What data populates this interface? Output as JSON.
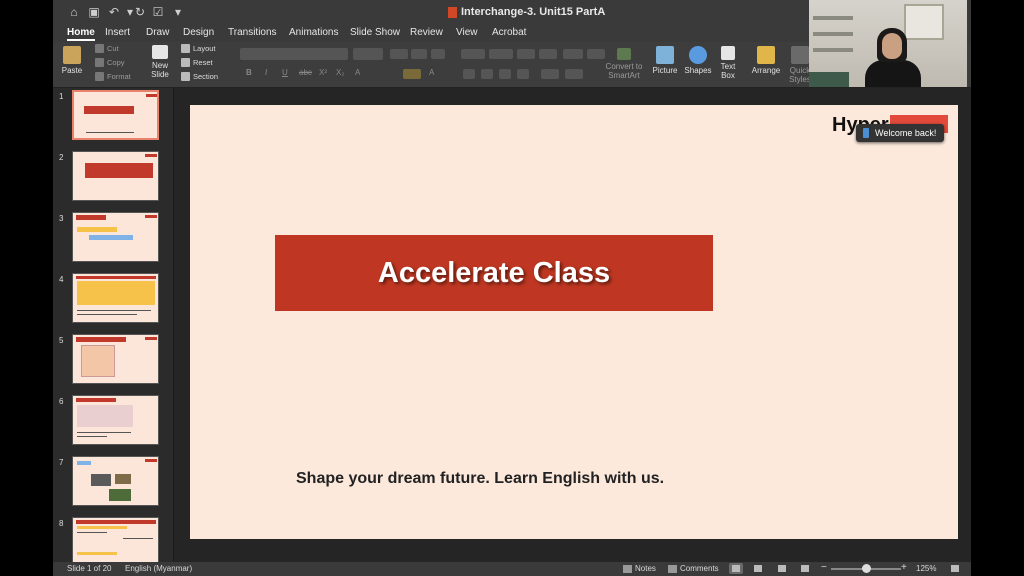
{
  "window": {
    "title": "Interchange-3. Unit15 PartA"
  },
  "ribbon_tabs": [
    "Home",
    "Insert",
    "Draw",
    "Design",
    "Transitions",
    "Animations",
    "Slide Show",
    "Review",
    "View",
    "Acrobat"
  ],
  "ribbon": {
    "paste": "Paste",
    "cut": "Cut",
    "copy": "Copy",
    "format": "Format",
    "new_slide_1": "New",
    "new_slide_2": "Slide",
    "layout": "Layout",
    "reset": "Reset",
    "section": "Section",
    "convert_1": "Convert to",
    "convert_2": "SmartArt",
    "picture": "Picture",
    "shapes": "Shapes",
    "textbox_1": "Text",
    "textbox_2": "Box",
    "arrange": "Arrange",
    "quick_styles_1": "Quick",
    "quick_styles_2": "Styles",
    "font_letters": [
      "B",
      "I",
      "U",
      "abc",
      "X²",
      "X₂",
      "A",
      "A"
    ]
  },
  "thumbnails": [
    "1",
    "2",
    "3",
    "4",
    "5",
    "6",
    "7",
    "8"
  ],
  "slide": {
    "title": "Accelerate Class",
    "tagline": "Shape your dream future. Learn English with us.",
    "logo_text": "Hyper",
    "banner_color": "#bf3722",
    "background_color": "#fce9dc"
  },
  "toast": {
    "text": "Welcome back!"
  },
  "status": {
    "slide_count": "Slide 1 of 20",
    "language": "English (Myanmar)",
    "notes": "Notes",
    "comments": "Comments",
    "zoom": "125%"
  }
}
